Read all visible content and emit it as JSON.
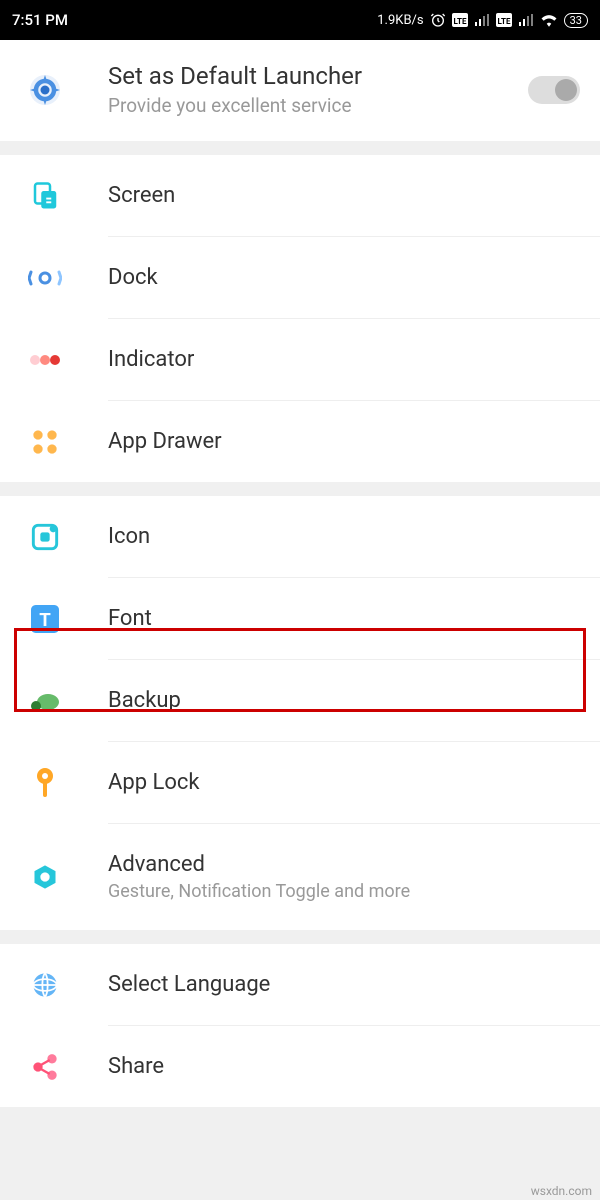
{
  "status_bar": {
    "time": "7:51 PM",
    "data_rate": "1.9KB/s",
    "battery": "33"
  },
  "header": {
    "title": "Set as Default Launcher",
    "subtitle": "Provide you excellent service",
    "toggle_on": false
  },
  "groups": [
    {
      "items": [
        {
          "id": "screen",
          "label": "Screen"
        },
        {
          "id": "dock",
          "label": "Dock"
        },
        {
          "id": "indicator",
          "label": "Indicator"
        },
        {
          "id": "app-drawer",
          "label": "App Drawer"
        }
      ]
    },
    {
      "items": [
        {
          "id": "icon",
          "label": "Icon"
        },
        {
          "id": "font",
          "label": "Font",
          "highlighted": true
        },
        {
          "id": "backup",
          "label": "Backup"
        },
        {
          "id": "app-lock",
          "label": "App Lock"
        },
        {
          "id": "advanced",
          "label": "Advanced",
          "subtitle": "Gesture, Notification Toggle and more"
        }
      ]
    },
    {
      "items": [
        {
          "id": "select-language",
          "label": "Select Language"
        },
        {
          "id": "share",
          "label": "Share"
        }
      ]
    }
  ],
  "watermark": "wsxdn.com"
}
